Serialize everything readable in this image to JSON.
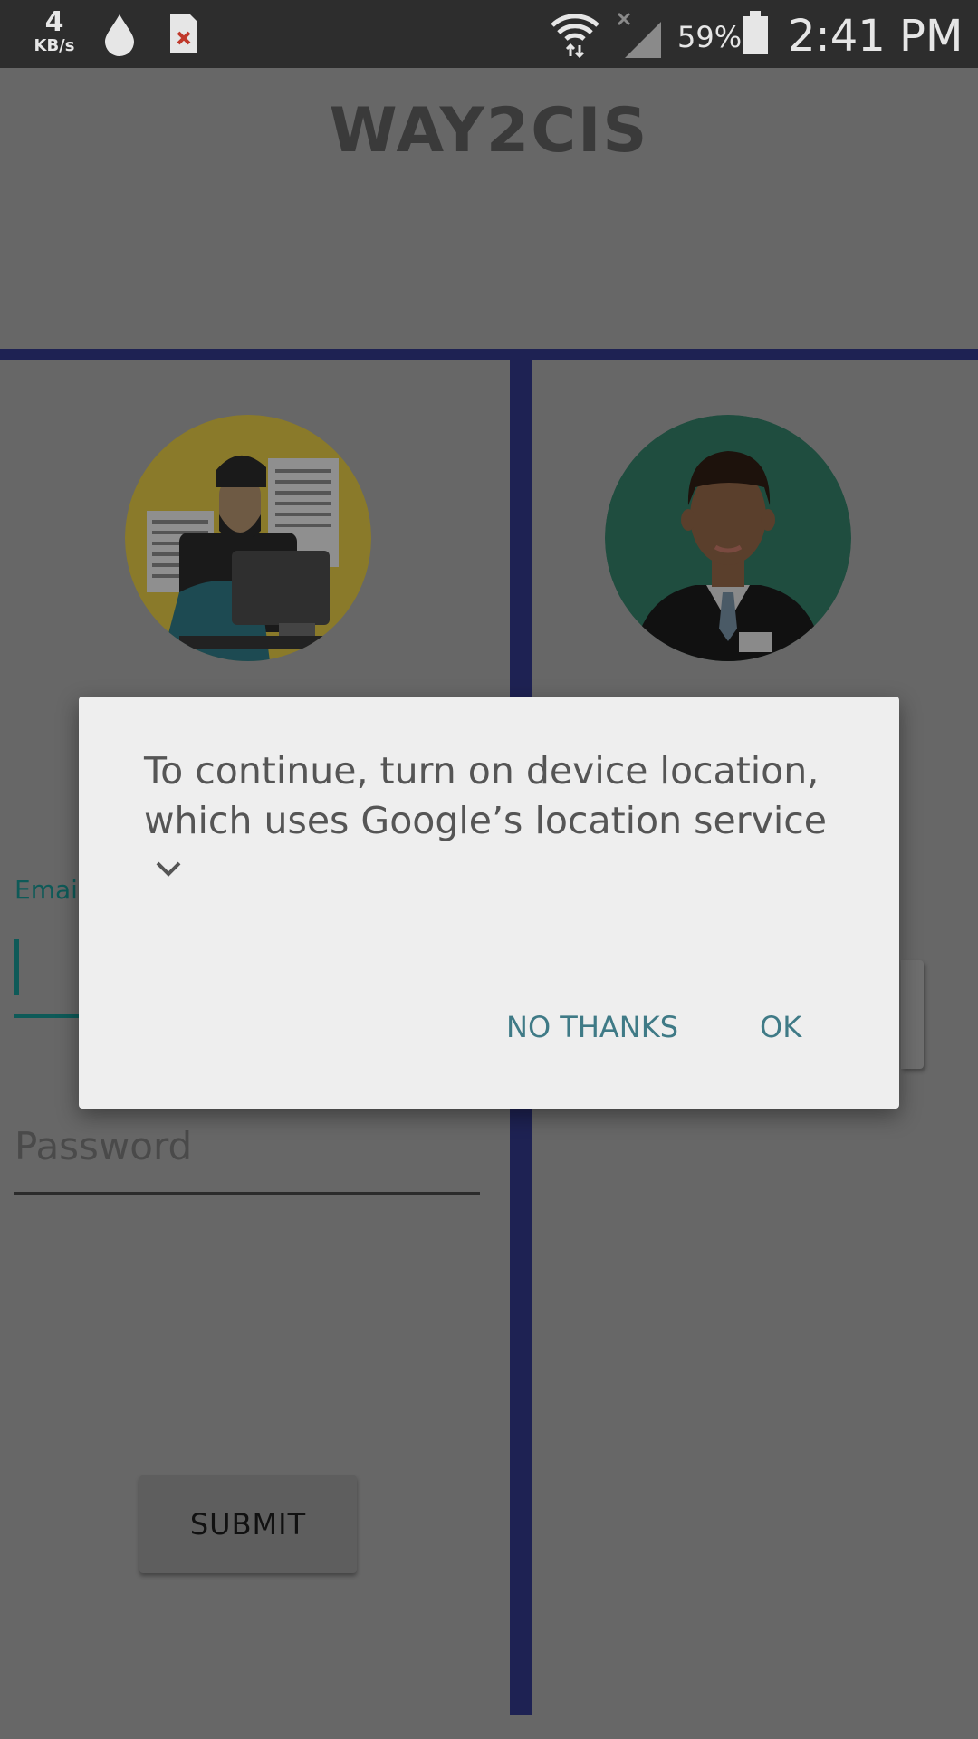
{
  "status_bar": {
    "speed_value": "4",
    "speed_unit": "KB/s",
    "battery": "59%",
    "time": "2:41 PM",
    "icons": [
      "data-drop-icon",
      "sim-error-icon",
      "wifi-icon",
      "signal-icon",
      "battery-icon"
    ]
  },
  "app": {
    "title": "WAY2CIS"
  },
  "login": {
    "email_label": "Email",
    "password_placeholder": "Password",
    "submit_label": "SUBMIT"
  },
  "dialog": {
    "message": "To continue, turn on device location, which uses Google’s location service",
    "no_thanks_label": "NO THANKS",
    "ok_label": "OK"
  },
  "colors": {
    "divider": "#1e2253",
    "accent": "#0e5a58",
    "dialog_button": "#3f7a86"
  }
}
